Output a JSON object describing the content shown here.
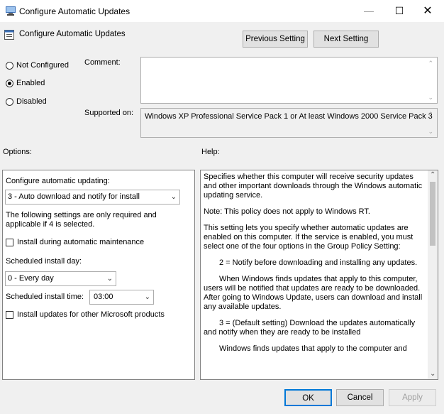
{
  "window": {
    "title": "Configure Automatic Updates",
    "minimize": "—",
    "maximize": "☐",
    "close": "✕"
  },
  "header": {
    "title": "Configure Automatic Updates",
    "prev_btn": "Previous Setting",
    "next_btn": "Next Setting"
  },
  "state": {
    "options": [
      "Not Configured",
      "Enabled",
      "Disabled"
    ],
    "selected": "Enabled"
  },
  "comment_label": "Comment:",
  "supported_label": "Supported on:",
  "supported_text": "Windows XP Professional Service Pack 1 or At least Windows 2000 Service Pack 3",
  "options_label": "Options:",
  "help_label": "Help:",
  "options": {
    "configure_label": "Configure automatic updating:",
    "configure_value": "3 - Auto download and notify for install",
    "note": "The following settings are only required and applicable if 4 is selected.",
    "install_maintenance": "Install during automatic maintenance",
    "sched_day_label": "Scheduled install day:",
    "sched_day_value": "0 - Every day",
    "sched_time_label": "Scheduled install time:",
    "sched_time_value": "03:00",
    "other_products": "Install updates for other Microsoft products"
  },
  "help": [
    "Specifies whether this computer will receive security updates and other important downloads through the Windows automatic updating service.",
    "Note: This policy does not apply to Windows RT.",
    "This setting lets you specify whether automatic updates are enabled on this computer. If the service is enabled, you must select one of the four options in the Group Policy Setting:",
    "2 = Notify before downloading and installing any updates.",
    "When Windows finds updates that apply to this computer, users will be notified that updates are ready to be downloaded. After going to Windows Update, users can download and install any available updates.",
    "3 = (Default setting) Download the updates automatically and notify when they are ready to be installed",
    "Windows finds updates that apply to the computer and"
  ],
  "footer": {
    "ok": "OK",
    "cancel": "Cancel",
    "apply": "Apply"
  },
  "colors": {
    "accent": "#0078d7",
    "disabled": "#a0a0a0"
  }
}
